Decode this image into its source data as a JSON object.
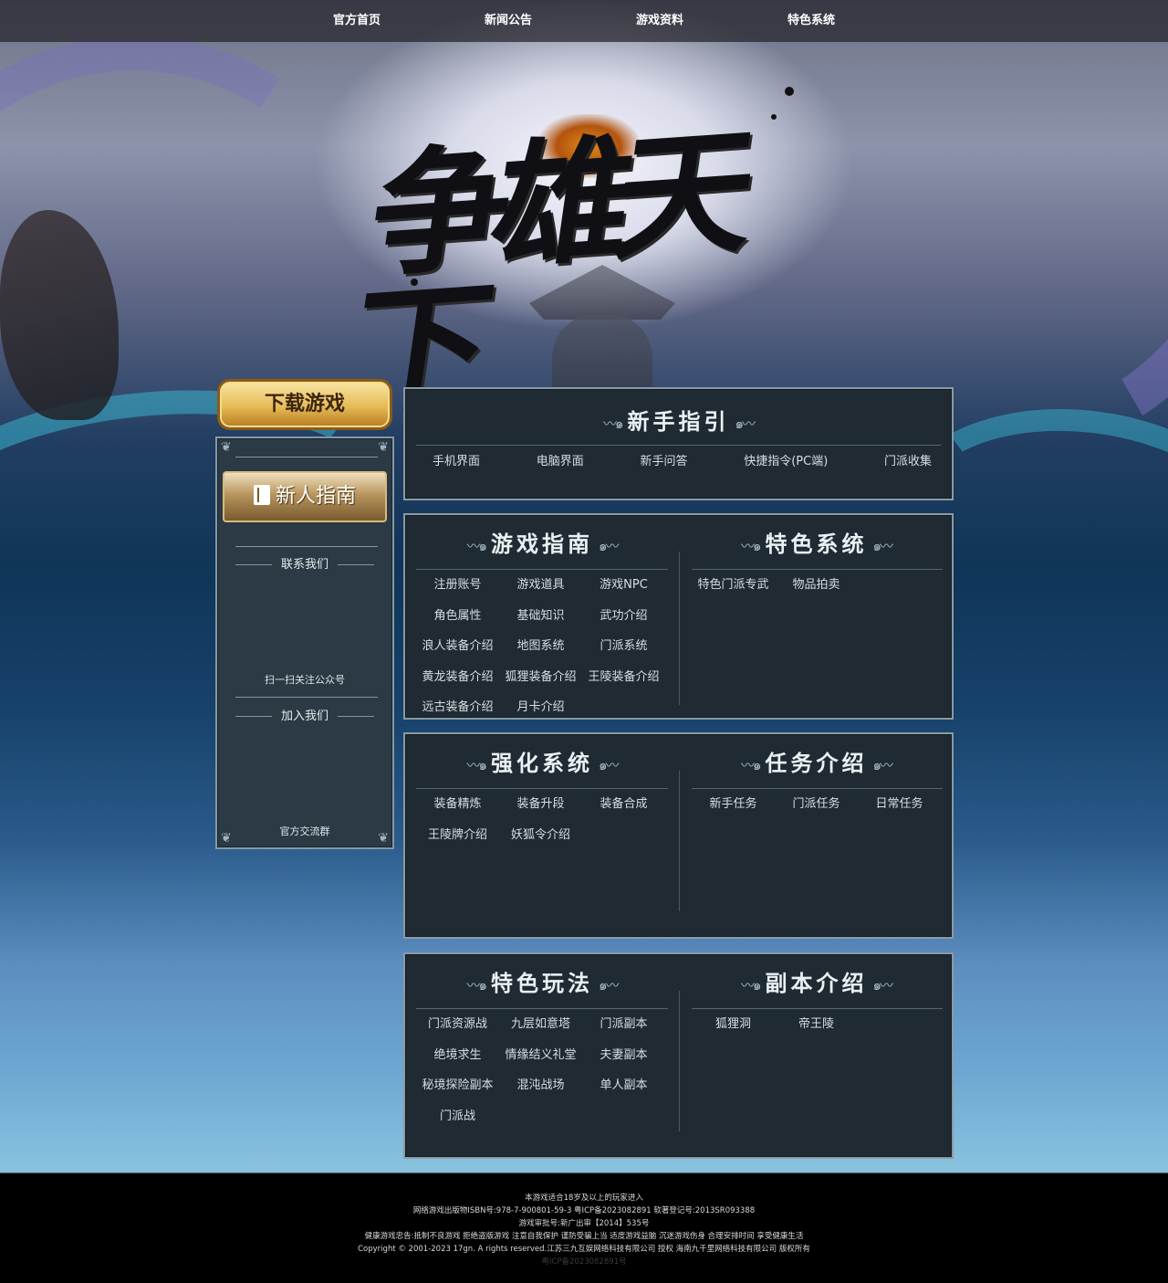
{
  "nav": {
    "items": [
      "官方首页",
      "新闻公告",
      "游戏资料",
      "特色系统"
    ]
  },
  "logo": {
    "text": "争雄天下"
  },
  "sidebar": {
    "download_label": "下载游戏",
    "guide_label": "新人指南",
    "contact_title": "联系我们",
    "contact_caption": "扫一扫关注公众号",
    "join_title": "加入我们",
    "join_caption": "官方交流群"
  },
  "newbie": {
    "title": "新手指引",
    "links": [
      "手机界面",
      "电脑界面",
      "新手问答",
      "快捷指令(PC端)",
      "门派收集"
    ]
  },
  "game_guide": {
    "title": "游戏指南",
    "links": [
      "注册账号",
      "游戏道具",
      "游戏NPC",
      "角色属性",
      "基础知识",
      "武功介绍",
      "浪人装备介绍",
      "地图系统",
      "门派系统",
      "黄龙装备介绍",
      "狐狸装备介绍",
      "王陵装备介绍",
      "远古装备介绍",
      "月卡介绍"
    ]
  },
  "features": {
    "title": "特色系统",
    "links": [
      "特色门派专武",
      "物品拍卖"
    ]
  },
  "enhance": {
    "title": "强化系统",
    "links": [
      "装备精炼",
      "装备升段",
      "装备合成",
      "王陵牌介绍",
      "妖狐令介绍"
    ]
  },
  "quests": {
    "title": "任务介绍",
    "links": [
      "新手任务",
      "门派任务",
      "日常任务"
    ]
  },
  "gameplay": {
    "title": "特色玩法",
    "links": [
      "门派资源战",
      "九层如意塔",
      "门派副本",
      "绝境求生",
      "情缘结义礼堂",
      "夫妻副本",
      "秘境探险副本",
      "混沌战场",
      "单人副本",
      "门派战"
    ]
  },
  "dungeons": {
    "title": "副本介绍",
    "links": [
      "狐狸洞",
      "帝王陵"
    ]
  },
  "footer": {
    "lines": [
      "本游戏适合18岁及以上的玩家进入",
      "网络游戏出版物ISBN号:978-7-900801-59-3 粤ICP备2023082891 软著登记号:2013SR093388",
      "游戏审批号:新广出审【2014】535号",
      "健康游戏忠告:抵制不良游戏 拒绝盗版游戏 注意自我保护 谨防受骗上当 适度游戏益脑 沉迷游戏伤身 合理安排时间 享受健康生活",
      "Copyright © 2001-2023 17gn. A rights reserved.江苏三九互娱网络科技有限公司 授权 海南九千里网络科技有限公司 版权所有",
      "粤ICP备2023082891号"
    ]
  }
}
